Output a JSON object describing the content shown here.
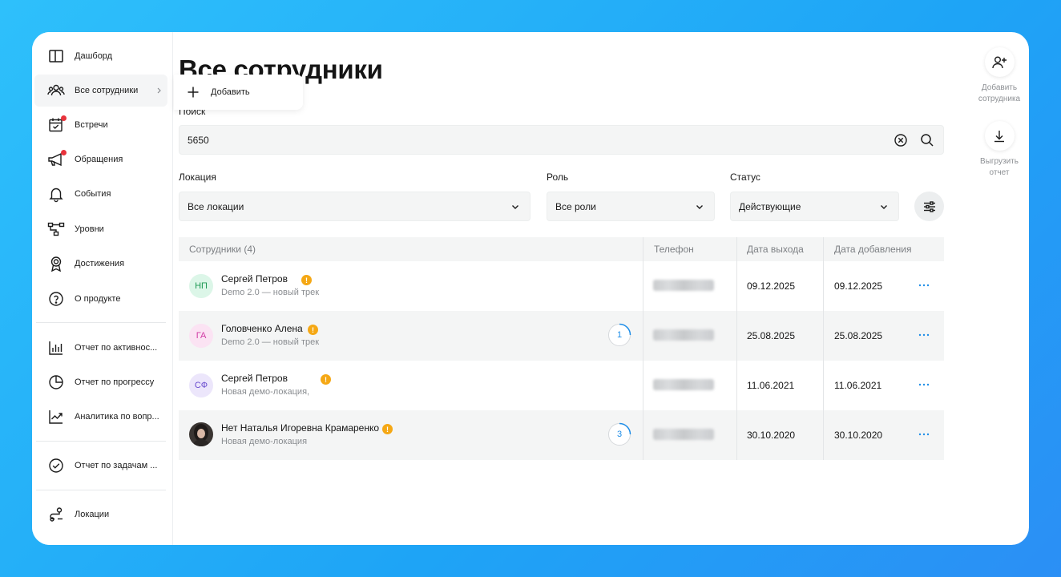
{
  "sidebar": {
    "items": [
      {
        "label": "Дашборд",
        "icon": "layout-icon"
      },
      {
        "label": "Все сотрудники",
        "icon": "users-icon"
      },
      {
        "label": "Встречи",
        "icon": "calendar-icon"
      },
      {
        "label": "Обращения",
        "icon": "megaphone-icon"
      },
      {
        "label": "События",
        "icon": "bell-icon"
      },
      {
        "label": "Уровни",
        "icon": "hierarchy-icon"
      },
      {
        "label": "Достижения",
        "icon": "award-icon"
      },
      {
        "label": "О продукте",
        "icon": "help-icon"
      },
      {
        "label": "Отчет по активнос...",
        "icon": "bar-chart-icon"
      },
      {
        "label": "Отчет по прогрессу",
        "icon": "pie-chart-icon"
      },
      {
        "label": "Аналитика по вопр...",
        "icon": "trend-icon"
      },
      {
        "label": "Отчет по задачам ...",
        "icon": "check-circle-icon"
      },
      {
        "label": "Локации",
        "icon": "route-icon"
      }
    ]
  },
  "popup": {
    "add_label": "Добавить"
  },
  "page": {
    "title": "Все сотрудники"
  },
  "search": {
    "label": "Поиск",
    "value": "5650"
  },
  "filters": {
    "location": {
      "label": "Локация",
      "value": "Все локации"
    },
    "role": {
      "label": "Роль",
      "value": "Все роли"
    },
    "status": {
      "label": "Статус",
      "value": "Действующие"
    }
  },
  "table": {
    "headers": {
      "employees": "Сотрудники (4)",
      "phone": "Телефон",
      "exit_date": "Дата выхода",
      "added_date": "Дата добавления"
    },
    "rows": [
      {
        "initials": "НП",
        "name": "Сергей Петров",
        "subtitle": "Demo 2.0 — новый трек",
        "exit_date": "09.12.2025",
        "added_date": "09.12.2025",
        "avatar_bg": "#dcf6e8",
        "avatar_fg": "#1f9a55"
      },
      {
        "initials": "ГА",
        "name": "Головченко Алена",
        "subtitle": "Demo 2.0 — новый трек",
        "progress": "1",
        "exit_date": "25.08.2025",
        "added_date": "25.08.2025",
        "avatar_bg": "#fbe3f3",
        "avatar_fg": "#d13aa4"
      },
      {
        "initials": "СФ",
        "name": "Сергей Петров",
        "subtitle": "Новая демо-локация,",
        "exit_date": "11.06.2021",
        "added_date": "11.06.2021",
        "avatar_bg": "#ece6fb",
        "avatar_fg": "#6a4ccf"
      },
      {
        "initials": "",
        "name": "Нет Наталья Игоревна Крамаренко",
        "subtitle": "Новая демо-локация",
        "progress": "3",
        "exit_date": "30.10.2020",
        "added_date": "30.10.2020"
      }
    ]
  },
  "actions": {
    "add_employee": "Добавить сотрудника",
    "export_report": "Выгрузить отчет"
  },
  "colors": {
    "accent": "#1f8ee8",
    "warning": "#f5a815",
    "badge": "#e8333c"
  }
}
